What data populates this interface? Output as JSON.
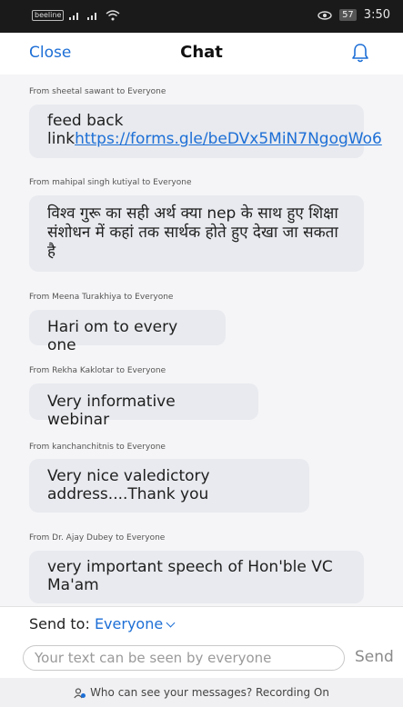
{
  "status_bar": {
    "carrier": "beeline",
    "time": "3:50",
    "battery": "57"
  },
  "header": {
    "close_label": "Close",
    "title": "Chat"
  },
  "messages": [
    {
      "sender": "From sheetal sawant to Everyone",
      "text": "feed back link",
      "link": "https://forms.gle/beDVx5MiN7NgogWo6"
    },
    {
      "sender": "From mahipal  singh kutiyal to Everyone",
      "text": "विश्व  गुरू का सही अर्थ क्या nep  के साथ हुए शिक्षा संशोधन में कहां तक सार्थक होते हुए देखा जा सकता है"
    },
    {
      "sender": "From Meena Turakhiya to Everyone",
      "text": "Hari om to every one"
    },
    {
      "sender": "From Rekha Kaklotar to Everyone",
      "text": "Very informative webinar"
    },
    {
      "sender": "From kanchanchitnis to Everyone",
      "text": "Very nice valedictory address....Thank you"
    },
    {
      "sender": "From Dr. Ajay Dubey to Everyone",
      "text": "very important speech of Hon'ble VC Ma'am"
    }
  ],
  "composer": {
    "send_to_label": "Send to:",
    "send_to_value": "Everyone",
    "placeholder": "Your text can be seen by everyone",
    "send_label": "Send"
  },
  "footer": {
    "text": "Who can see your messages? Recording On"
  },
  "colors": {
    "accent": "#1d6fd6",
    "bubble": "#e8eaef"
  }
}
